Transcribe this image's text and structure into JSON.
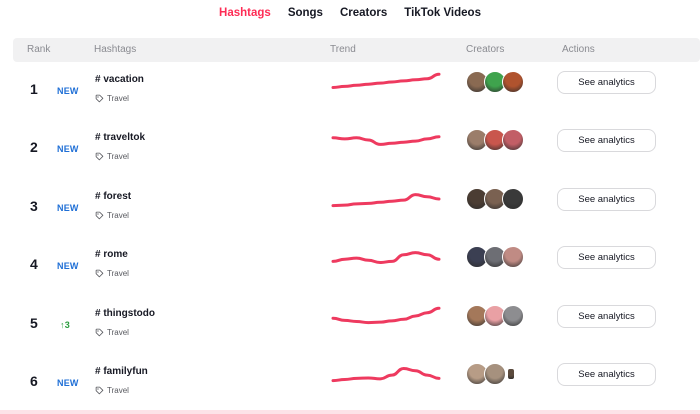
{
  "nav": {
    "tabs": [
      "Hashtags",
      "Songs",
      "Creators",
      "TikTok Videos"
    ]
  },
  "table": {
    "columns": [
      "Rank",
      "Hashtags",
      "Trend",
      "Creators",
      "Actions"
    ],
    "rows": [
      {
        "rank": "1",
        "change": "NEW",
        "hashtag": "# vacation",
        "industry": "Travel",
        "action": "See analytics",
        "trend": [
          0.25,
          0.3,
          0.35,
          0.4,
          0.45,
          0.5,
          0.55,
          0.6,
          0.65,
          0.85
        ],
        "creators": [
          "#8a6a52",
          "#3fa34d",
          "#b0532e"
        ]
      },
      {
        "rank": "2",
        "change": "NEW",
        "hashtag": "# traveltok",
        "industry": "Travel",
        "action": "See analytics",
        "trend": [
          0.6,
          0.55,
          0.6,
          0.5,
          0.3,
          0.35,
          0.4,
          0.45,
          0.55,
          0.65
        ],
        "creators": [
          "#9b7d6a",
          "#c9564d",
          "#c25e66"
        ]
      },
      {
        "rank": "3",
        "change": "NEW",
        "hashtag": "# forest",
        "industry": "Travel",
        "action": "See analytics",
        "trend": [
          0.2,
          0.22,
          0.28,
          0.3,
          0.35,
          0.4,
          0.45,
          0.7,
          0.6,
          0.5
        ],
        "creators": [
          "#4b3d33",
          "#7a6151",
          "#3a3a3a"
        ]
      },
      {
        "rank": "4",
        "change": "NEW",
        "hashtag": "# rome",
        "industry": "Travel",
        "action": "See analytics",
        "trend": [
          0.3,
          0.4,
          0.45,
          0.35,
          0.25,
          0.3,
          0.6,
          0.7,
          0.6,
          0.4
        ],
        "creators": [
          "#3b3f52",
          "#6d6e74",
          "#c08b84"
        ]
      },
      {
        "rank": "5",
        "change": "↑3",
        "hashtag": "# thingstodo",
        "industry": "Travel",
        "action": "See analytics",
        "trend": [
          0.4,
          0.3,
          0.25,
          0.2,
          0.22,
          0.28,
          0.35,
          0.5,
          0.65,
          0.85
        ],
        "creators": [
          "#a4785a",
          "#e9a0a4",
          "#8d8d90"
        ]
      },
      {
        "rank": "6",
        "change": "NEW",
        "hashtag": "# familyfun",
        "industry": "Travel",
        "action": "See analytics",
        "trend": [
          0.2,
          0.25,
          0.3,
          0.32,
          0.28,
          0.45,
          0.75,
          0.65,
          0.45,
          0.3
        ],
        "creators": [
          "#b79c86",
          "#a6917e",
          "#5b4a3d"
        ]
      }
    ]
  },
  "colors": {
    "accent": "#fe2c55",
    "new_badge": "#1f6fd6",
    "up_badge": "#2b9d3f",
    "trend_line": "#ee3a5f"
  },
  "icons": {
    "industry": "tag-icon"
  }
}
